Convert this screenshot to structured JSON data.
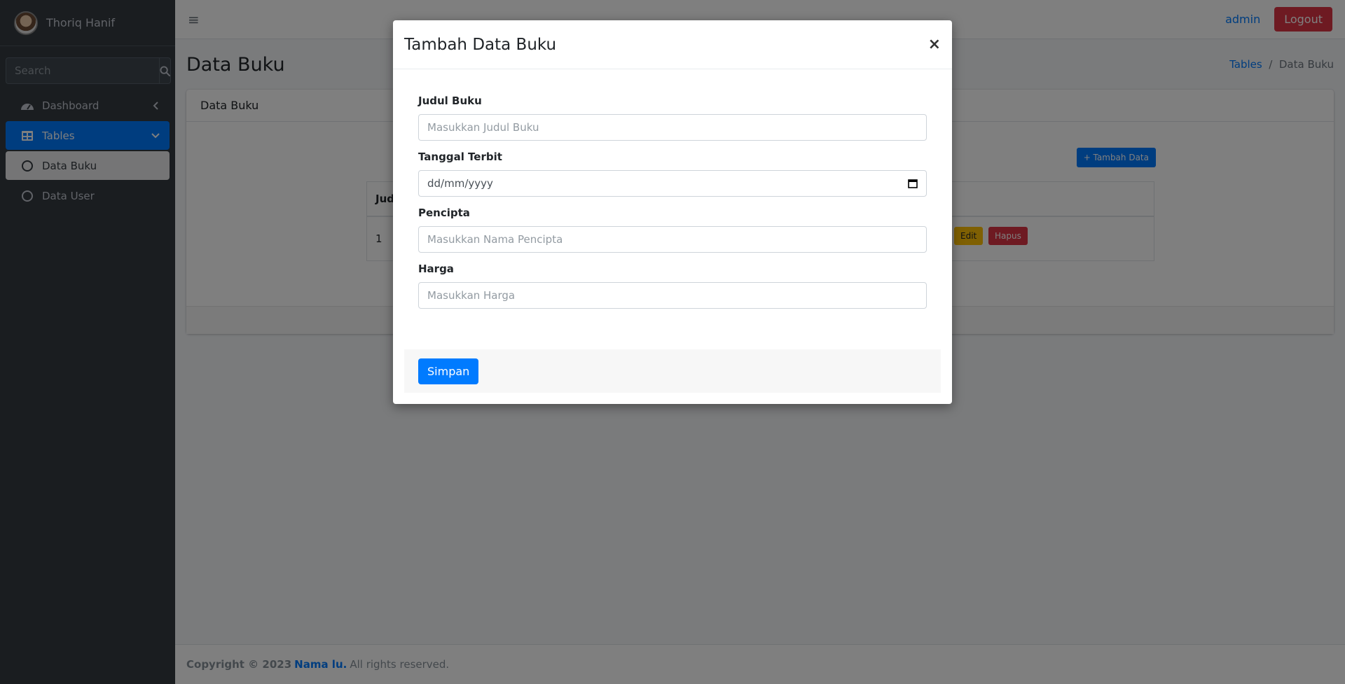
{
  "sidebar": {
    "user_name": "Thoriq Hanif",
    "search_placeholder": "Search",
    "items": [
      {
        "label": "Dashboard"
      },
      {
        "label": "Tables"
      },
      {
        "label": "Data Buku"
      },
      {
        "label": "Data User"
      }
    ]
  },
  "navbar": {
    "user_link": "admin",
    "logout_label": "Logout"
  },
  "content": {
    "page_title": "Data Buku",
    "breadcrumb": [
      "Tables",
      "/",
      "Data Buku"
    ],
    "card_title": "Data Buku",
    "add_button": "+ Tambah Data",
    "table_header_first": "Jud",
    "table_row_no": "1",
    "edit_label": "Edit",
    "delete_label": "Hapus"
  },
  "footer": {
    "copyright": "Copyright © 2023",
    "brand": "Nama lu.",
    "rights": "All rights reserved."
  },
  "modal": {
    "title": "Tambah Data Buku",
    "close": "×",
    "fields": [
      {
        "label": "Judul Buku",
        "placeholder": "Masukkan Judul Buku"
      },
      {
        "label": "Tanggal Terbit",
        "placeholder": "dd/mm/yyyy"
      },
      {
        "label": "Pencipta",
        "placeholder": "Masukkan Nama Pencipta"
      },
      {
        "label": "Harga",
        "placeholder": "Masukkan Harga"
      }
    ],
    "save_label": "Simpan"
  },
  "colors": {
    "primary": "#007bff",
    "danger": "#dc3545",
    "warning": "#ffc107",
    "sidebar_bg": "#343a40"
  }
}
